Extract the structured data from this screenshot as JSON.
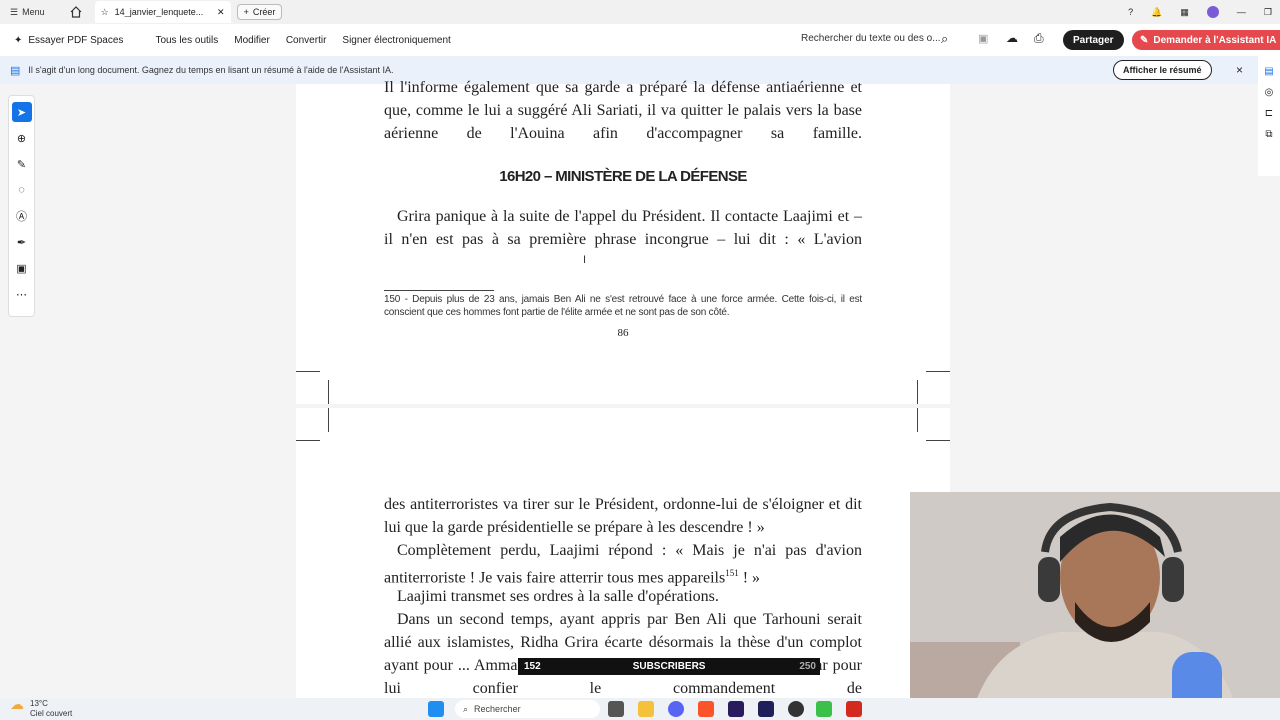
{
  "browser": {
    "menu_label": "Menu",
    "tab_title": "14_janvier_lenquete...",
    "create_label": "Créer"
  },
  "toolbar": {
    "try_spaces": "Essayer PDF Spaces",
    "all_tools": "Tous les outils",
    "edit": "Modifier",
    "convert": "Convertir",
    "sign": "Signer électroniquement",
    "search_placeholder": "Rechercher du texte ou des o...",
    "share": "Partager",
    "ask_ai": "Demander à l'Assistant IA"
  },
  "notice": {
    "text": "Il s'agit d'un long document. Gagnez du temps en lisant un résumé à l'aide de l'Assistant IA.",
    "show_summary": "Afficher le résumé",
    "close": "×"
  },
  "page1": {
    "paragraph_top": "Il l'informe également que sa garde a préparé la défense antiaérienne et que, comme le lui a suggéré Ali Sariati, il va quitter le palais vers la base aérienne de l'Aouina afin d'accompagner sa famille.",
    "heading": "16H20 – MINISTÈRE DE LA DÉFENSE",
    "paragraph_2": "Grira panique à la suite de l'appel du Président. Il contacte Laajimi et – il n'en est pas à sa première phrase incongrue – lui dit : « L'avion",
    "footnote": "150 - Depuis plus de 23 ans, jamais Ben Ali ne s'est retrouvé face à une force armée. Cette fois-ci, il est conscient que ces hommes font partie de l'élite armée et ne sont pas de son côté.",
    "page_number": "86"
  },
  "page2": {
    "p1": "des antiterroristes va tirer sur le Président, ordonne-lui de s'éloigner et dit lui que la garde présidentielle se prépare à les descendre ! »",
    "p2_a": "Complètement perdu, Laajimi répond : « Mais je n'ai pas d'avion antiterroriste ! Je vais faire atterrir tous mes appareils",
    "p2_sup": "151",
    "p2_b": " ! »",
    "p3": "Laajimi transmet ses ordres à la salle d'opérations.",
    "p4": "Dans un second temps, ayant appris par Ben Ali que Tarhouni serait allié aux islamistes, Ridha Grira écarte désormais la thèse d'un complot ayant pour ... Ammar et Ali Seriati. Il décide alors d'appeler Ammar pour lui confier le commandement de"
  },
  "overlay": {
    "left_count": "152",
    "label": "SUBSCRIBERS",
    "right_count": "250"
  },
  "taskbar": {
    "temp": "13°C",
    "weather": "Ciel couvert",
    "search": "Rechercher"
  }
}
